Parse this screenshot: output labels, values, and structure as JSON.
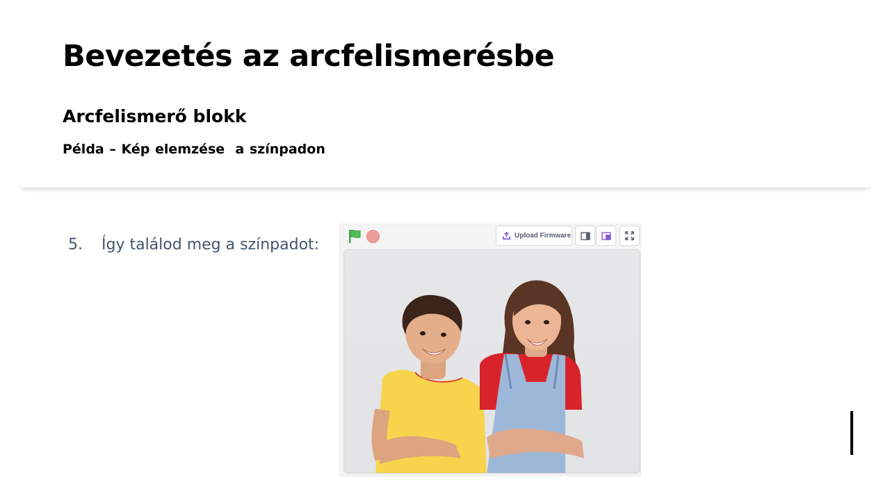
{
  "slide": {
    "title": "Bevezetés az arcfelismerésbe",
    "subtitle": "Arcfelismerő blokk",
    "example": "Példa – Kép elemzése  a színpadon"
  },
  "step": {
    "number": "5.",
    "text": "Így találod meg a színpadot:"
  },
  "stage_toolbar": {
    "upload_label": "Upload Firmware",
    "icons": [
      "green-flag-icon",
      "stop-icon",
      "upload-icon",
      "small-stage-icon",
      "large-stage-icon",
      "fullscreen-icon"
    ]
  },
  "colors": {
    "step_text": "#44546a",
    "flag": "#4cbf56",
    "stop": "#ee9c9c",
    "accent": "#855cd6"
  }
}
